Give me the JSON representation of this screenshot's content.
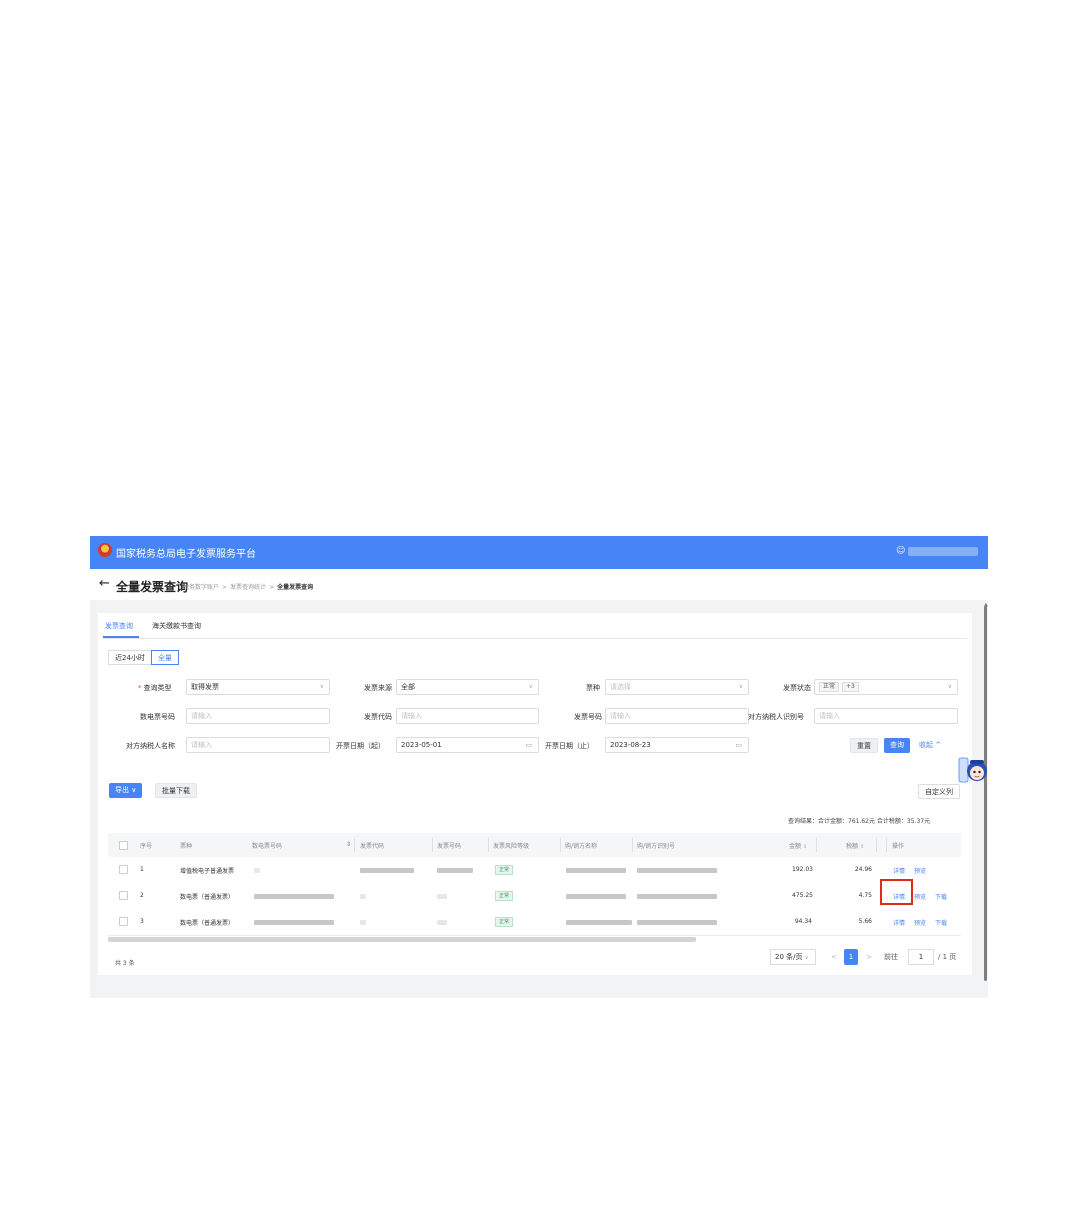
{
  "header": {
    "brand": "国家税务总局电子发票服务平台",
    "user_icon": "user-icon"
  },
  "titlebar": {
    "back_icon": "←",
    "title": "全量发票查询",
    "breadcrumb": [
      "税务数字账户",
      "发票查询统计",
      "全量发票查询"
    ],
    "separator": ">"
  },
  "tabs": [
    {
      "label": "发票查询",
      "active": true
    },
    {
      "label": "海关缴款书查询",
      "active": false
    }
  ],
  "range": {
    "options": [
      "近24小时",
      "全量"
    ],
    "selected": "全量"
  },
  "filters": {
    "query_type": {
      "label": "查询类型",
      "required": "*",
      "value": "取得发票"
    },
    "source": {
      "label": "发票来源",
      "value": "全部"
    },
    "ticket_type": {
      "label": "票种",
      "placeholder": "请选择"
    },
    "status": {
      "label": "发票状态",
      "tag": "正常",
      "more": "+3"
    },
    "digital_no": {
      "label": "数电票号码",
      "placeholder": "请输入"
    },
    "invoice_code": {
      "label": "发票代码",
      "placeholder": "请输入"
    },
    "invoice_no": {
      "label": "发票号码",
      "placeholder": "请输入"
    },
    "counterparty_id": {
      "label": "对方纳税人识别号",
      "placeholder": "请输入"
    },
    "counterparty_name": {
      "label": "对方纳税人名称",
      "placeholder": "请输入"
    },
    "date_from": {
      "label": "开票日期（起）",
      "value": "2023-05-01"
    },
    "date_to": {
      "label": "开票日期（止）",
      "value": "2023-08-23"
    }
  },
  "buttons": {
    "reset": "重置",
    "query": "查询",
    "collapse": "收起 ^",
    "export": "导出 ∨",
    "batch_download": "批量下载",
    "custom_columns": "自定义列"
  },
  "summary": "查询结果：合计金额：761.62元  合计税额：35.37元",
  "table": {
    "columns": [
      "序号",
      "票种",
      "数电票号码",
      "发票代码",
      "发票号码",
      "发票风险等级",
      "购/销方名称",
      "购/销方识别号",
      "金额",
      "税额",
      "操作"
    ],
    "rows": [
      {
        "index": "1",
        "type": "增值税电子普通发票",
        "risk": "正常",
        "amount": "192.03",
        "tax": "24.96",
        "actions": [
          "详情",
          "预览"
        ]
      },
      {
        "index": "2",
        "type": "数电票（普通发票）",
        "risk": "正常",
        "amount": "475.25",
        "tax": "4.75",
        "actions": [
          "详情",
          "预览",
          "下载"
        ]
      },
      {
        "index": "3",
        "type": "数电票（普通发票）",
        "risk": "正常",
        "amount": "94.34",
        "tax": "5.66",
        "actions": [
          "详情",
          "预览",
          "下载"
        ]
      }
    ]
  },
  "pager": {
    "total": "共 3 条",
    "page_size": "20 条/页",
    "prev": "<",
    "current": "1",
    "next": ">",
    "jump_label": "前往",
    "jump_value": "1",
    "page_total": "/ 1 页"
  },
  "colors": {
    "primary": "#4784f5",
    "highlight": "#e0291b",
    "success": "#31a06a"
  }
}
